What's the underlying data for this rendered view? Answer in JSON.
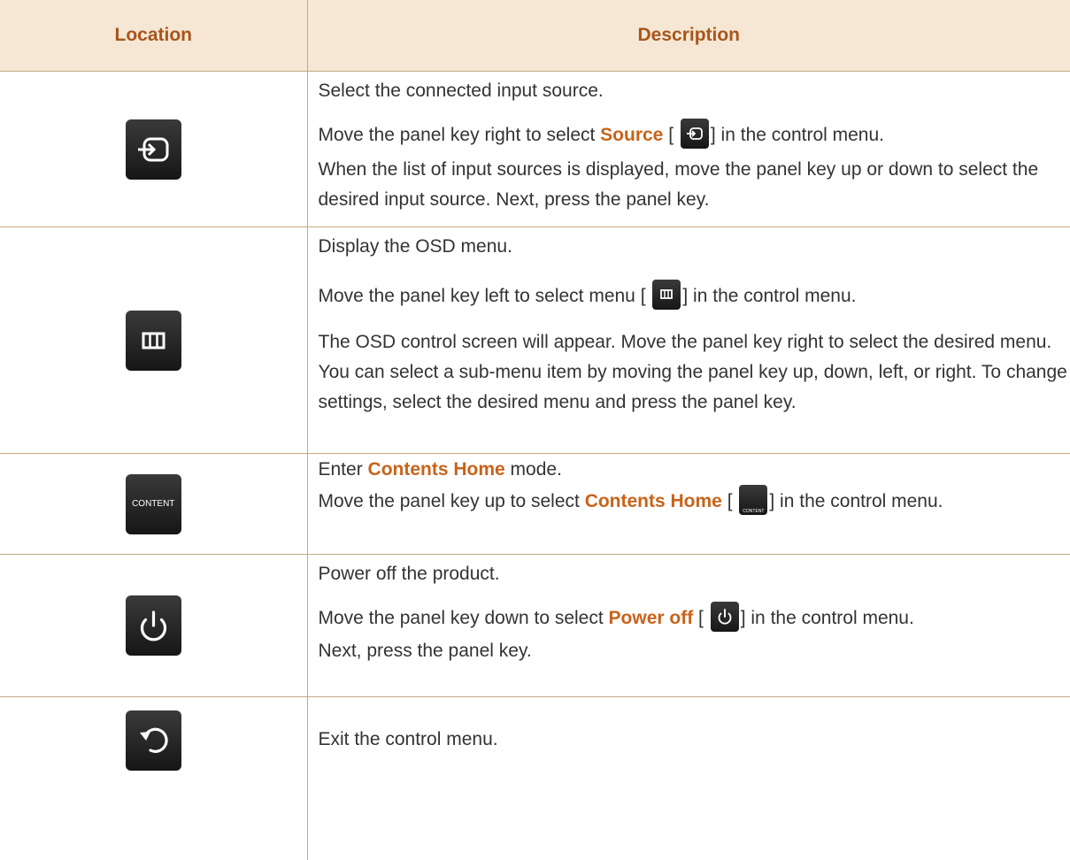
{
  "table": {
    "headers": {
      "location": "Location",
      "description": "Description"
    },
    "rows": [
      {
        "icon": "source-icon",
        "p1": "Select the connected input source.",
        "p2_pre": "Move the panel key right to select ",
        "p2_hl": "Source",
        "p2_open": " [",
        "p2_close": "] in the control menu.",
        "p3": "When the list of input sources is displayed, move the panel key up or down to select the desired input source. Next, press the panel key."
      },
      {
        "icon": "menu-icon",
        "p1": "Display the OSD menu.",
        "p2_pre": "Move the panel key left to select menu [",
        "p2_close": "] in the control menu.",
        "p3": "The OSD control screen will appear. Move the panel key right to select the desired menu. You can select a sub-menu item by moving the panel key up, down, left, or right. To change settings, select the desired menu and press the panel key."
      },
      {
        "icon": "content-icon",
        "icon_text": "CONTENT",
        "p1_pre": "Enter ",
        "p1_hl": "Contents Home",
        "p1_post": " mode.",
        "p2_pre": "Move the panel key up to select ",
        "p2_hl": "Contents Home",
        "p2_open": " [",
        "p2_close": "] in the control menu."
      },
      {
        "icon": "power-icon",
        "p1": "Power off the product.",
        "p2_pre": "Move the panel key down to select ",
        "p2_hl": "Power off",
        "p2_open": " [",
        "p2_close": "] in the control menu.",
        "p3": "Next, press the panel key."
      },
      {
        "icon": "return-icon",
        "p1": "Exit the control menu."
      }
    ]
  },
  "colors": {
    "header_bg": "#f5e7d4",
    "header_text": "#a8551c",
    "highlight": "#c8631a",
    "border": "#c4a984"
  }
}
